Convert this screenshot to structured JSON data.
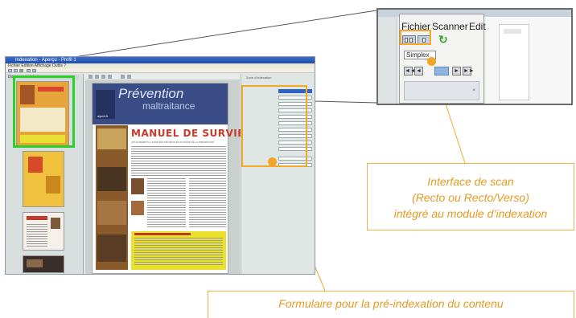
{
  "app": {
    "window_title": "Indexation - Aperçu - Profil 1",
    "menu": "Fichier  Edition  Affichage  Outils  ?",
    "thumb_panel_label": "Documents à indexer",
    "form_header": "Zone d'indexation"
  },
  "preview": {
    "title": "Prévention",
    "subtitle": "maltraitance",
    "url": "alpeb.fr",
    "headline": "MANUEL DE SURVIE",
    "tagline": "VOUS REMETS A JOUR DES PROJETS ET ACTIONS DE LA PREVENTION"
  },
  "inset": {
    "menu_items": [
      "Fichier",
      "Scanner",
      "Editio"
    ],
    "dropdown_value": "Simplex",
    "nav_first": "◄◄",
    "nav_prev": "◄",
    "nav_next": "►",
    "nav_last": "►►",
    "close": "×"
  },
  "callouts": {
    "scan_line1": "Interface de scan",
    "scan_line2": "(Recto ou Recto/Verso)",
    "scan_line3": "intégré au module d’indexation",
    "form_text": "Formulaire pour la pré-indexation du contenu"
  },
  "colors": {
    "callout_orange": "#f4a82a",
    "selection_green": "#2bd12b",
    "callout_text": "#e59a22"
  }
}
